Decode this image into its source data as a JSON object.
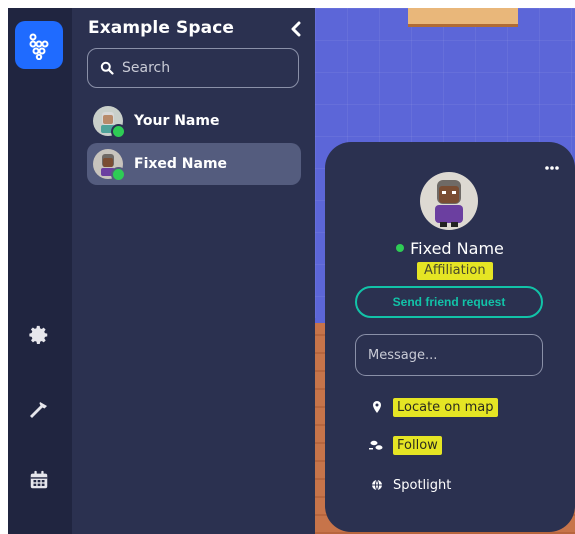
{
  "space": {
    "title": "Example Space",
    "search_placeholder": "Search"
  },
  "members": [
    {
      "name": "Your Name",
      "status": "online",
      "selected": false
    },
    {
      "name": "Fixed Name",
      "status": "online",
      "selected": true
    }
  ],
  "rail": {
    "icons": [
      "app-logo-icon",
      "settings-gear-icon",
      "build-hammer-icon",
      "calendar-icon"
    ]
  },
  "profile_card": {
    "name": "Fixed Name",
    "affiliation": "Affiliation",
    "friend_button_label": "Send friend request",
    "message_placeholder": "Message...",
    "actions": [
      {
        "label": "Locate on map",
        "icon": "location-pin-icon",
        "highlighted": true
      },
      {
        "label": "Follow",
        "icon": "follow-footsteps-icon",
        "highlighted": true
      },
      {
        "label": "Spotlight",
        "icon": "globe-icon",
        "highlighted": false
      }
    ]
  },
  "colors": {
    "accent_teal": "#12c3a8",
    "online_green": "#2ecc55",
    "highlight_yellow": "#e5e524",
    "logo_blue": "#1f6bff",
    "panel_bg": "#2b3150",
    "rail_bg": "#202540"
  }
}
